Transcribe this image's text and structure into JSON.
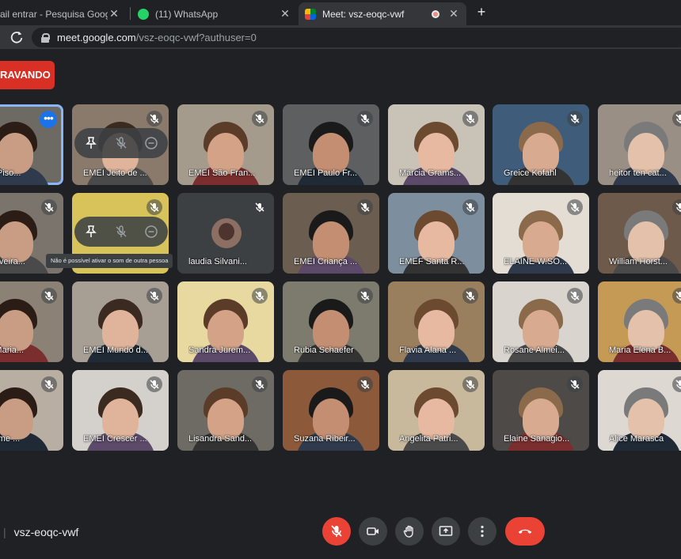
{
  "browser": {
    "tabs": [
      {
        "title": "ail entrar - Pesquisa Google",
        "close": "✕"
      },
      {
        "title": "(11) WhatsApp",
        "close": "✕"
      },
      {
        "title": "Meet: vsz-eoqc-vwf",
        "close": "✕"
      }
    ],
    "new_tab": "+",
    "url_host": "meet.google.com",
    "url_path": "/vsz-eoqc-vwf?authuser=0"
  },
  "meet": {
    "recording_label": "RAVANDO",
    "meeting_code": "vsz-eoqc-vwf",
    "tooltip": "Não é possível ativar o som de outra pessoa",
    "colors": {
      "accent": "#8ab4f8",
      "red": "#ea4335",
      "surface": "#3c4043"
    },
    "participants": [
      "iane Piso...",
      "EMEI Jeito de ...",
      "EMEI São Fran...",
      "EMEI Paulo Fr...",
      "Márcia Grams...",
      "Greice Kofahl",
      "heitor ten cat...",
      "se Silveira...",
      "",
      "laudia Silvani...",
      "EMEI Criança ...",
      "EMEF Santa R...",
      "ELAINE W.SO...",
      "William Horst...",
      "nge Maria...",
      "EMEI Mundo d...",
      "Sandra Jurem...",
      "Rubia Schaefer",
      "Flavia Alana ...",
      "Rosane Almei...",
      "Maria Elena B...",
      "Bem me ...",
      "EMEI Crescer ...",
      "Lisandra Sand...",
      "Suzana Ribeir...",
      "Angelita Patri...",
      "Elaine Sanagio...",
      "Alice Marasca"
    ]
  }
}
